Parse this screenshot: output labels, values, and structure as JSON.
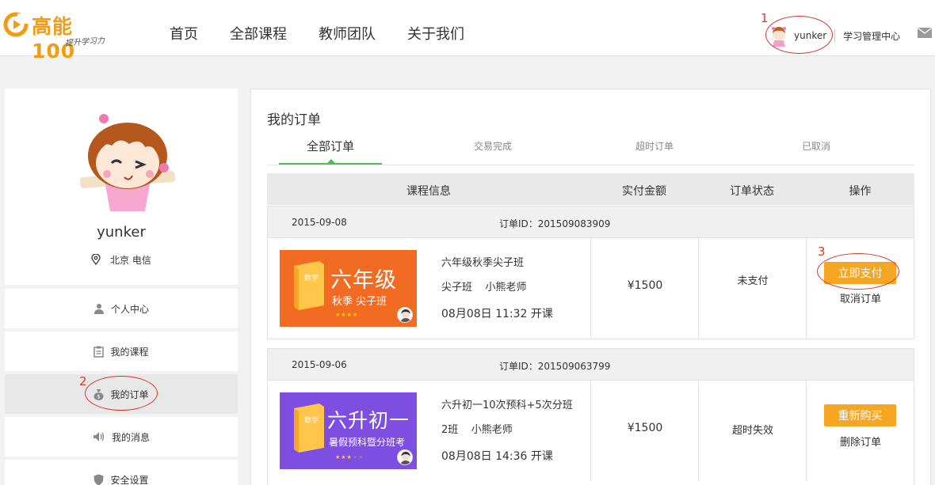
{
  "header": {
    "logo_text": "高能100",
    "logo_slogan": "提升学习力",
    "nav": [
      "首页",
      "全部课程",
      "教师团队",
      "关于我们"
    ],
    "username": "yunker",
    "center_link": "学习管理中心"
  },
  "annotations": [
    "1",
    "2",
    "3"
  ],
  "profile": {
    "name": "yunker",
    "location": "北京 电信"
  },
  "sidebar": {
    "items": [
      {
        "label": "个人中心",
        "icon": "user-card-icon"
      },
      {
        "label": "我的课程",
        "icon": "clipboard-icon"
      },
      {
        "label": "我的订单",
        "icon": "money-bag-icon",
        "active": true
      },
      {
        "label": "我的消息",
        "icon": "speaker-icon"
      },
      {
        "label": "安全设置",
        "icon": "shield-icon"
      }
    ]
  },
  "main": {
    "title": "我的订单",
    "tabs": [
      "全部订单",
      "交易完成",
      "超时订单",
      "已取消"
    ],
    "active_tab": 0,
    "columns": [
      "课程信息",
      "实付金额",
      "订单状态",
      "操作"
    ],
    "orders": [
      {
        "date": "2015-09-08",
        "order_id": "订单ID：201509083909",
        "thumb_title": "六年级",
        "thumb_sub": "秋季 尖子班",
        "thumb_book": "数学",
        "thumb_color": "#f26b22",
        "course_name": "六年级秋季尖子班",
        "course_class": "尖子班    小熊老师",
        "course_time": "08月08日 11:32 开课",
        "amount": "¥1500",
        "status": "未支付",
        "primary_action": "立即支付",
        "secondary_action": "取消订单"
      },
      {
        "date": "2015-09-06",
        "order_id": "订单ID：201509063799",
        "thumb_title": "六升初一",
        "thumb_sub": "暑假预科暨分班考",
        "thumb_book": "数学",
        "thumb_color": "#7e4ee0",
        "course_name": "六升初一10次预科+5次分班",
        "course_class": "2班    小熊老师",
        "course_time": "08月08日 14:36 开课",
        "amount": "¥1500",
        "status": "超时失效",
        "primary_action": "重新购买",
        "secondary_action": "删除订单"
      }
    ]
  },
  "colors": {
    "accent": "#f5a623",
    "tab_active": "#5cb85c",
    "annotation": "#e0352b"
  }
}
